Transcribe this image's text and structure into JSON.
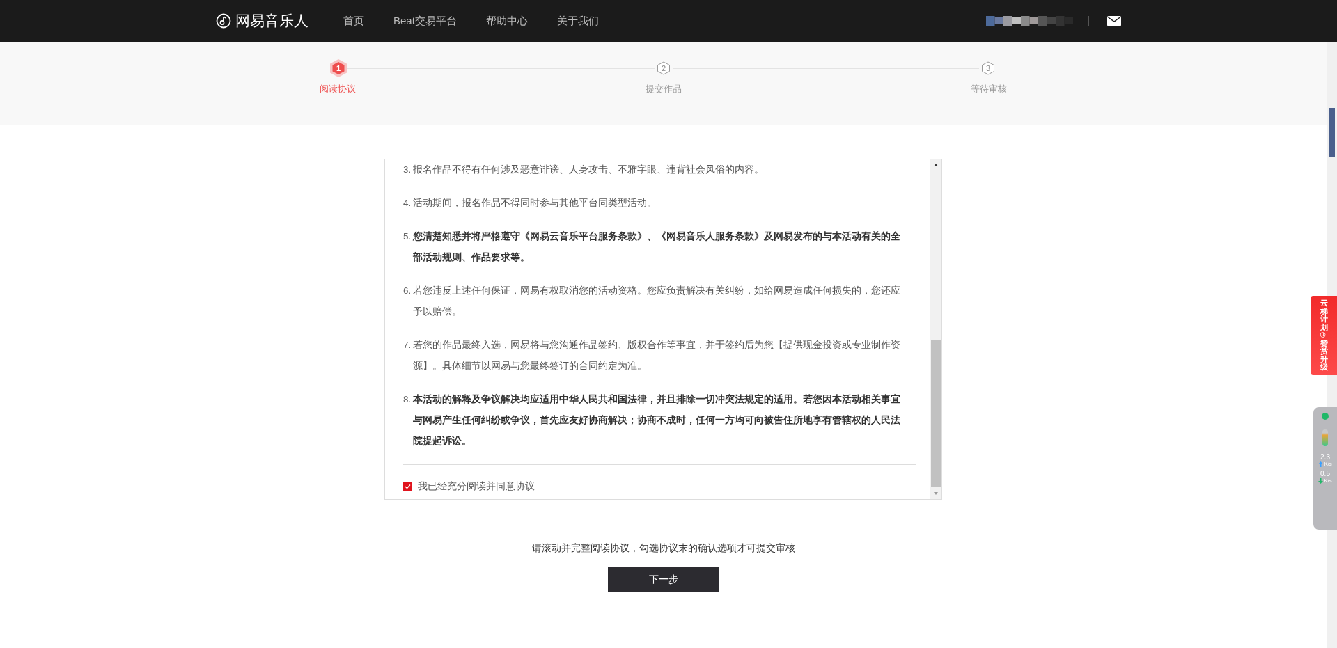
{
  "header": {
    "logo": "网易音乐人",
    "nav": [
      {
        "label": "首页",
        "selected": false
      },
      {
        "label": "Beat交易平台",
        "selected": false
      },
      {
        "label": "帮助中心",
        "selected": false
      },
      {
        "label": "关于我们",
        "selected": false
      }
    ]
  },
  "steps": [
    {
      "number": "1",
      "label": "阅读协议",
      "selected": true
    },
    {
      "number": "2",
      "label": "提交作品",
      "selected": false
    },
    {
      "number": "3",
      "label": "等待审核",
      "selected": false
    }
  ],
  "agreement": {
    "items": [
      {
        "number": "3.",
        "text": "报名作品不得有任何涉及恶意诽谤、人身攻击、不雅字眼、违背社会风俗的内容。",
        "bold": false
      },
      {
        "number": "4.",
        "text": "活动期间，报名作品不得同时参与其他平台同类型活动。",
        "bold": false
      },
      {
        "number": "5.",
        "text": "您清楚知悉并将严格遵守《网易云音乐平台服务条款》、《网易音乐人服务条款》及网易发布的与本活动有关的全部活动规则、作品要求等。",
        "bold": true
      },
      {
        "number": "6.",
        "text": "若您违反上述任何保证，网易有权取消您的活动资格。您应负责解决有关纠纷，如给网易造成任何损失的，您还应予以赔偿。",
        "bold": false
      },
      {
        "number": "7.",
        "text": "若您的作品最终入选，网易将与您沟通作品签约、版权合作等事宜，并于签约后为您【提供现金投资或专业制作资源】。具体细节以网易与您最终签订的合同约定为准。",
        "bold": false
      },
      {
        "number": "8.",
        "text": "本活动的解释及争议解决均应适用中华人民共和国法律，并且排除一切冲突法规定的适用。若您因本活动相关事宜与网易产生任何纠纷或争议，首先应友好协商解决；协商不成时，任何一方均可向被告住所地享有管辖权的人民法院提起诉讼。",
        "bold": true
      }
    ],
    "consent": {
      "label": "我已经充分阅读并同意协议",
      "checked": true
    }
  },
  "hint": "请滚动并完整阅读协议，勾选协议末的确认选项才可提交审核",
  "next_button": "下一步",
  "side_tab": "云梯计划®赞赏升级",
  "speed_widget": {
    "upload": "2.3",
    "upload_unit": "K/s",
    "download": "0.5",
    "download_unit": "K/s"
  }
}
